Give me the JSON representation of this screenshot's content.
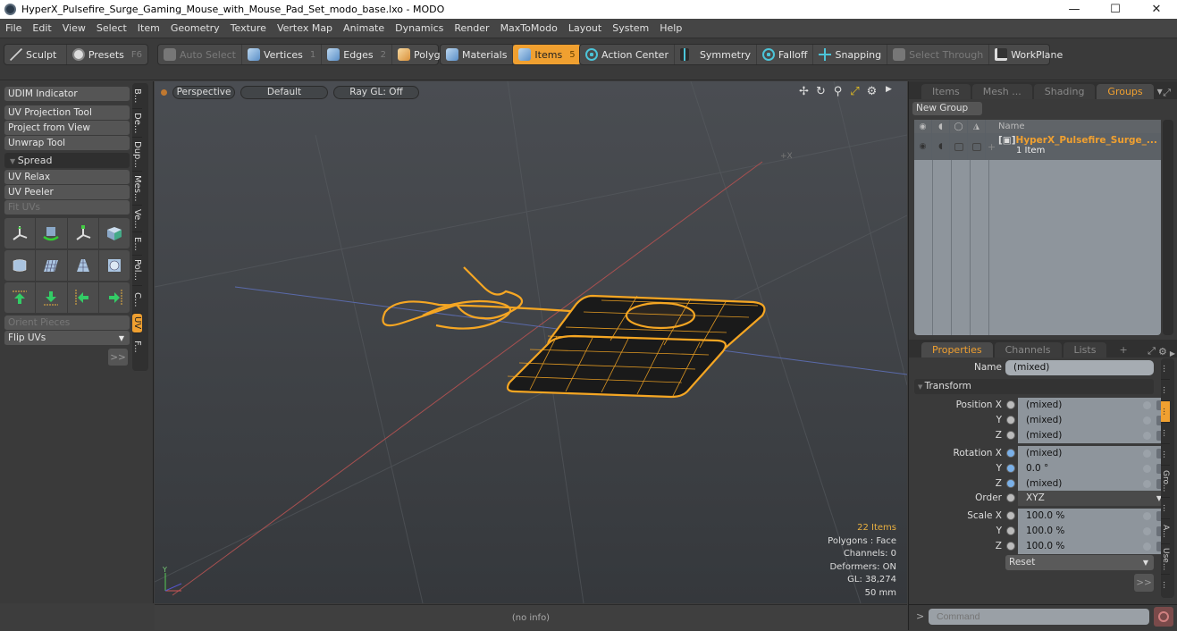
{
  "window": {
    "title": "HyperX_Pulsefire_Surge_Gaming_Mouse_with_Mouse_Pad_Set_modo_base.lxo - MODO",
    "controls": {
      "minimize": "—",
      "maximize": "☐",
      "close": "✕"
    }
  },
  "menu": [
    "File",
    "Edit",
    "View",
    "Select",
    "Item",
    "Geometry",
    "Texture",
    "Vertex Map",
    "Animate",
    "Dynamics",
    "Render",
    "MaxToModo",
    "Layout",
    "System",
    "Help"
  ],
  "toolbar": {
    "sculpt": "Sculpt",
    "presets": "Presets",
    "presets_key": "F6",
    "auto_select": "Auto Select",
    "vertices": "Vertices",
    "vertices_key": "1",
    "edges": "Edges",
    "edges_key": "2",
    "polygons": "Polygons",
    "materials": "Materials",
    "items": "Items",
    "items_key": "5",
    "action_center": "Action Center",
    "symmetry": "Symmetry",
    "falloff": "Falloff",
    "snapping": "Snapping",
    "select_through": "Select Through",
    "workplane": "WorkPlane"
  },
  "left_panel": {
    "udim": "UDIM Indicator",
    "tools": [
      "UV Projection Tool",
      "Project from View",
      "Unwrap Tool"
    ],
    "section": "Spread",
    "tools2": [
      "UV Relax",
      "UV Peeler",
      "Fit UVs"
    ],
    "orient": "Orient Pieces",
    "flip": "Flip UVs",
    "more": ">>",
    "vtabs": [
      "B...",
      "De...",
      "Dup...",
      "Mes...",
      "Ve...",
      "E...",
      "Pol...",
      "C...",
      "UV",
      "F..."
    ],
    "active_vtab": "UV"
  },
  "viewport": {
    "view": "Perspective",
    "shading": "Default",
    "raygl": "Ray GL: Off",
    "info": {
      "items": "22 Items",
      "polygons": "Polygons : Face",
      "channels": "Channels: 0",
      "deformers": "Deformers: ON",
      "gl": "GL: 38,274",
      "scale": "50 mm"
    },
    "status": "(no info)",
    "axis_label": "Y"
  },
  "groups_panel": {
    "tabs": [
      "Items",
      "Mesh ...",
      "Shading",
      "Groups"
    ],
    "active_tab": "Groups",
    "new_group": "New Group",
    "column_name": "Name",
    "row": {
      "name": "HyperX_Pulsefire_Surge_...",
      "sub": "1 Item"
    }
  },
  "properties_panel": {
    "tabs": [
      "Properties",
      "Channels",
      "Lists",
      "+"
    ],
    "active_tab": "Properties",
    "name_label": "Name",
    "name_value": "(mixed)",
    "section": "Transform",
    "rows": [
      {
        "label": "Position X",
        "value": "(mixed)"
      },
      {
        "label": "Y",
        "value": "(mixed)"
      },
      {
        "label": "Z",
        "value": "(mixed)"
      },
      {
        "label": "Rotation X",
        "value": "(mixed)"
      },
      {
        "label": "Y",
        "value": "0.0 °"
      },
      {
        "label": "Z",
        "value": "(mixed)"
      },
      {
        "label": "Order",
        "value": "XYZ"
      },
      {
        "label": "Scale X",
        "value": "100.0 %"
      },
      {
        "label": "Y",
        "value": "100.0 %"
      },
      {
        "label": "Z",
        "value": "100.0 %"
      }
    ],
    "reset": "Reset",
    "more": ">>",
    "vtabs": [
      "...",
      "...",
      "...",
      "...",
      "...",
      "Gro...",
      "...",
      "A...",
      "Use...",
      "..."
    ],
    "command_placeholder": "Command",
    "command_prompt": ">"
  },
  "colors": {
    "accent": "#f0a030",
    "wireframe": "#f5a623",
    "panel": "#3a3a3a"
  }
}
